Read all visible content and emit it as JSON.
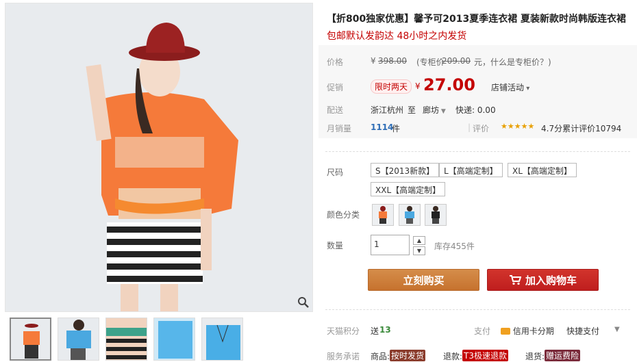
{
  "product": {
    "title": "【折800独家优惠】馨予可2013夏季连衣裙 夏装新款时尚韩版连衣裙",
    "subtitle": "包邮默认发韵达 48小时之内发货"
  },
  "price": {
    "label": "价格",
    "currency": "¥",
    "original": "398.00",
    "counter_note_prefix": "(专柜价",
    "counter_price": "209.00",
    "counter_note_suffix": "元，什么是专柜价？)"
  },
  "promo": {
    "label": "促销",
    "tag": "限时两天",
    "currency": "¥",
    "price": "27.00",
    "shop_activity": "店铺活动"
  },
  "shipping": {
    "label": "配送",
    "from": "浙江杭州",
    "to_word": "至",
    "dest": "廊坊",
    "express": "快递: 0.00"
  },
  "sales": {
    "label": "月销量",
    "count": "1114",
    "unit": "件",
    "review_label": "评价",
    "stars": "★★★★★",
    "score": "4.7分累计评价10794"
  },
  "size": {
    "label": "尺码",
    "options": [
      "S【2013新款】",
      "L【高端定制】",
      "XL【高端定制】",
      "XXL【高端定制】"
    ]
  },
  "color": {
    "label": "颜色分类",
    "options": [
      "orange",
      "blue",
      "black"
    ]
  },
  "quantity": {
    "label": "数量",
    "value": "1",
    "stock": "库存455件"
  },
  "buttons": {
    "buy": "立刻购买",
    "cart": "加入购物车"
  },
  "points": {
    "label": "天猫积分",
    "give_prefix": "送",
    "give_value": "13",
    "pay_label": "支付",
    "credit": "信用卡分期",
    "quick": "快捷支付"
  },
  "service": {
    "label": "服务承诺",
    "goods": "商品:",
    "goods_badge": "按时发货",
    "refund": "退款:",
    "refund_badge": "T3极速退款",
    "return": "退货:",
    "return_badge": "赠运费险"
  },
  "colors": {
    "accent_red": "#c40000",
    "buy_orange": "#c6722e",
    "cart_red": "#bf1e1e"
  }
}
